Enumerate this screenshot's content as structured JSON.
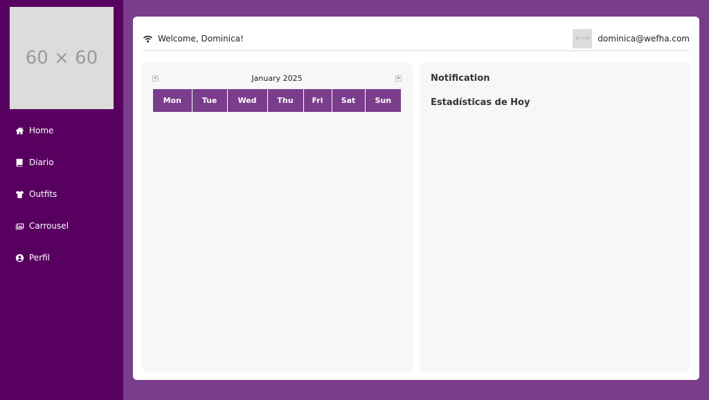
{
  "sidebar": {
    "logo_text": "60 × 60",
    "items": [
      {
        "label": "Home",
        "icon": "home-icon"
      },
      {
        "label": "Diario",
        "icon": "book-icon"
      },
      {
        "label": "Outfits",
        "icon": "shirt-icon"
      },
      {
        "label": "Carrousel",
        "icon": "images-icon"
      },
      {
        "label": "Perfil",
        "icon": "user-circle-icon"
      }
    ]
  },
  "header": {
    "welcome": "Welcome, Dominica!",
    "avatar_text": "60 × 60",
    "email": "dominica@wefha.com"
  },
  "calendar": {
    "month_label": "January 2025",
    "prev_label": "<",
    "next_label": ">",
    "days": [
      "Mon",
      "Tue",
      "Wed",
      "Thu",
      "Fri",
      "Sat",
      "Sun"
    ]
  },
  "right_panel": {
    "notification_title": "Notification",
    "stats_title": "Estadísticas de Hoy"
  },
  "colors": {
    "background": "#7a3d8c",
    "sidebar": "#570060",
    "calendar_header": "#7a3d8c"
  }
}
